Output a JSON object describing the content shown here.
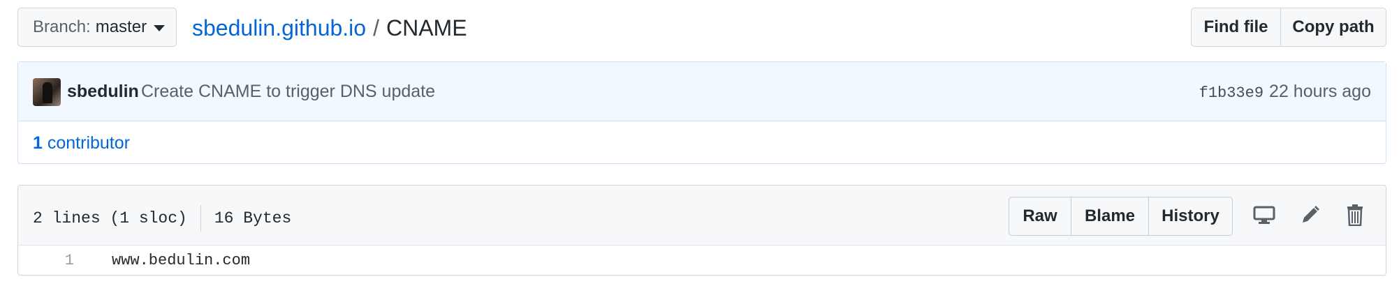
{
  "branch": {
    "label": "Branch:",
    "value": "master"
  },
  "breadcrumb": {
    "repo": "sbedulin.github.io",
    "separator": "/",
    "file": "CNAME"
  },
  "header_buttons": {
    "find_file": "Find file",
    "copy_path": "Copy path"
  },
  "commit": {
    "author": "sbedulin",
    "message": "Create CNAME to trigger DNS update",
    "sha": "f1b33e9",
    "time": "22 hours ago"
  },
  "contributors": {
    "count": "1",
    "label": "contributor"
  },
  "file_info": {
    "lines": "2 lines (1 sloc)",
    "size": "16 Bytes"
  },
  "file_buttons": {
    "raw": "Raw",
    "blame": "Blame",
    "history": "History"
  },
  "icons": [
    "desktop-icon",
    "pencil-icon",
    "trash-icon",
    "caret-down-icon"
  ],
  "code": [
    {
      "line": "1",
      "text": "www.bedulin.com"
    }
  ],
  "colors": {
    "link": "#0366d6",
    "commit_bg": "#f1f8ff",
    "commit_border": "#c8e1ff",
    "button_bg": "#f6f8fa"
  }
}
